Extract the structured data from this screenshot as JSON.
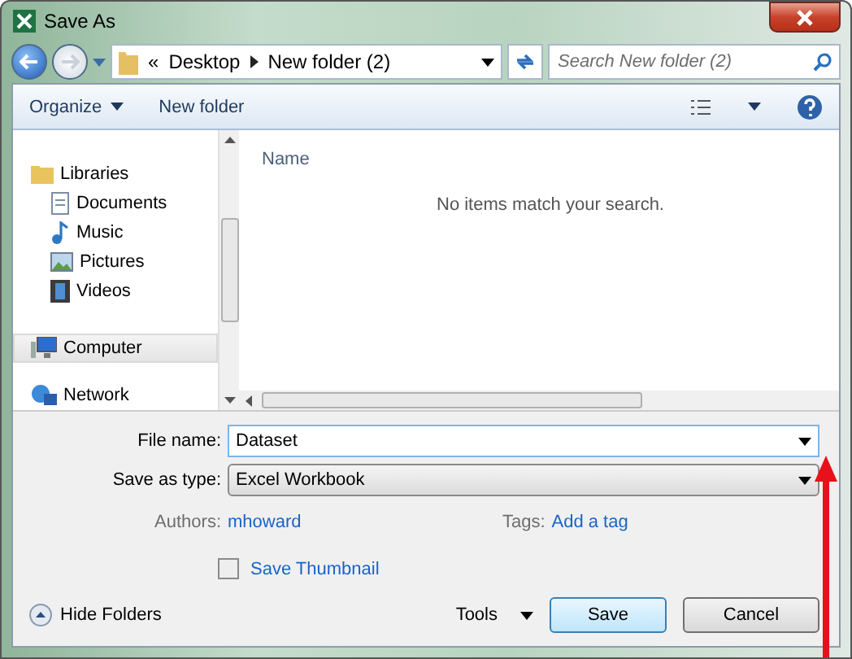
{
  "window": {
    "title": "Save As"
  },
  "address": {
    "overflow": "«",
    "path": [
      "Desktop",
      "New folder (2)"
    ]
  },
  "search": {
    "placeholder": "Search New folder (2)"
  },
  "toolbar": {
    "organize": "Organize",
    "new_folder": "New folder"
  },
  "sidebar": {
    "items": [
      {
        "label": "Libraries",
        "kind": "libraries",
        "selected": false,
        "children": [
          {
            "label": "Documents",
            "kind": "documents",
            "selected": false
          },
          {
            "label": "Music",
            "kind": "music",
            "selected": false
          },
          {
            "label": "Pictures",
            "kind": "pictures",
            "selected": false
          },
          {
            "label": "Videos",
            "kind": "videos",
            "selected": false
          }
        ]
      },
      {
        "label": "Computer",
        "kind": "computer",
        "selected": true
      },
      {
        "label": "Network",
        "kind": "network",
        "selected": false
      }
    ]
  },
  "file_list": {
    "columns": [
      "Name"
    ],
    "empty_message": "No items match your search."
  },
  "form": {
    "file_name_label": "File name:",
    "file_name": "Dataset",
    "type_label": "Save as type:",
    "type": "Excel Workbook",
    "authors_label": "Authors:",
    "authors": "mhoward",
    "tags_label": "Tags:",
    "tags": "Add a tag",
    "thumbnail": {
      "label": "Save Thumbnail",
      "checked": false
    }
  },
  "footer": {
    "hide_folders": "Hide Folders",
    "tools": "Tools",
    "save": "Save",
    "cancel": "Cancel"
  }
}
